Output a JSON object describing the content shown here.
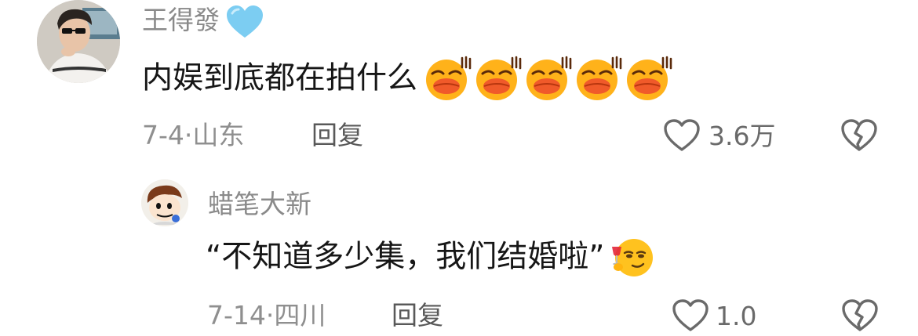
{
  "comments": [
    {
      "username": "王得發",
      "badge_icon": "blue-heart-icon",
      "text": "内娱到底都在拍什么",
      "emojis": [
        "laughing-emoji",
        "laughing-emoji",
        "laughing-emoji",
        "laughing-emoji",
        "laughing-emoji"
      ],
      "date": "7-4",
      "location": "山东",
      "reply_label": "回复",
      "like_count": "3.6万",
      "like_icon": "heart-outline-icon",
      "dislike_icon": "broken-heart-icon"
    },
    {
      "username": "蜡笔大新",
      "text": "“不知道多少集，我们结婚啦”",
      "emoji": "toasting-emoji",
      "date": "7-14",
      "location": "四川",
      "reply_label": "回复",
      "like_count": "1.0",
      "like_icon": "heart-outline-icon",
      "dislike_icon": "broken-heart-icon"
    }
  ],
  "separator": "·",
  "colors": {
    "username": "#8a8a8a",
    "content": "#161616",
    "meta": "#8f8f8f",
    "badge_heart": "#7ccdf2",
    "emoji_face": "#ffb21a",
    "emoji_lips": "#f05a2a"
  }
}
